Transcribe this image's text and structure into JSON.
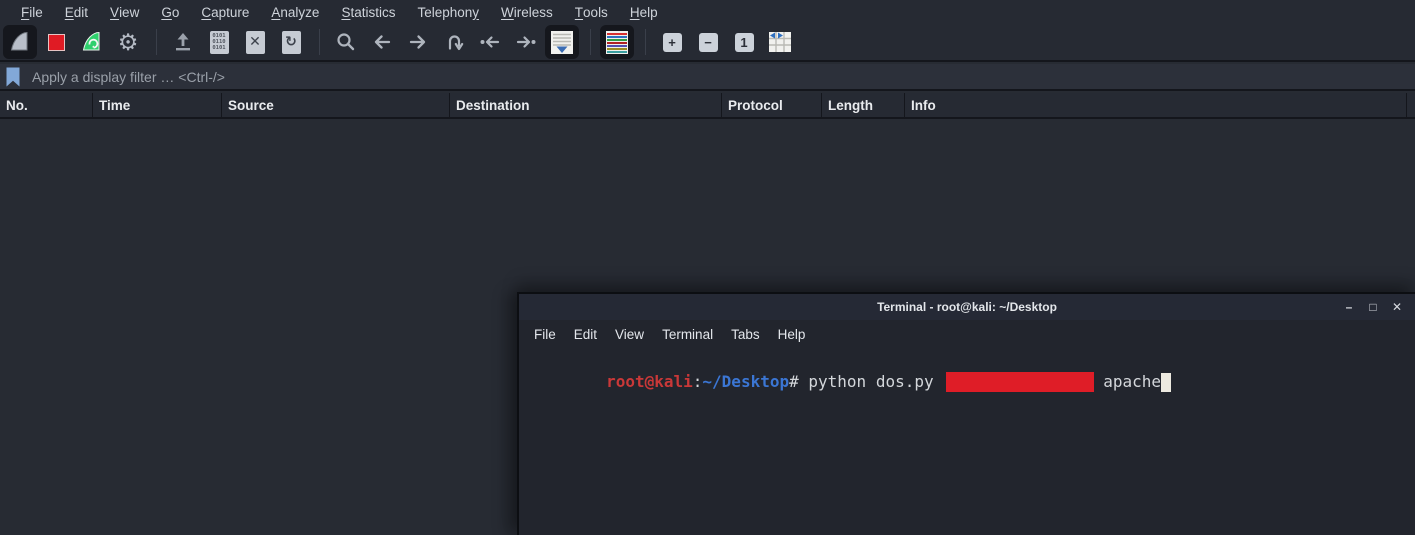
{
  "wireshark": {
    "menu": [
      {
        "pre": "",
        "u": "F",
        "rest": "ile"
      },
      {
        "pre": "",
        "u": "E",
        "rest": "dit"
      },
      {
        "pre": "",
        "u": "V",
        "rest": "iew"
      },
      {
        "pre": "",
        "u": "G",
        "rest": "o"
      },
      {
        "pre": "",
        "u": "C",
        "rest": "apture"
      },
      {
        "pre": "",
        "u": "A",
        "rest": "nalyze"
      },
      {
        "pre": "",
        "u": "S",
        "rest": "tatistics"
      },
      {
        "pre": "Telephon",
        "u": "y",
        "rest": ""
      },
      {
        "pre": "",
        "u": "W",
        "rest": "ireless"
      },
      {
        "pre": "",
        "u": "T",
        "rest": "ools"
      },
      {
        "pre": "",
        "u": "H",
        "rest": "elp"
      }
    ],
    "toolbar_icons": [
      "start-capture-shark-fin",
      "stop-capture",
      "restart-capture",
      "capture-options-gear",
      "open-capture",
      "save-capture",
      "close-capture",
      "reload-capture",
      "find-packet",
      "go-back",
      "go-forward",
      "go-to-packet",
      "first-packet",
      "last-packet",
      "auto-scroll",
      "colorize-packets",
      "zoom-in",
      "zoom-out",
      "normal-size",
      "resize-columns"
    ],
    "filter": {
      "placeholder": "Apply a display filter … <Ctrl-/>"
    },
    "columns": [
      {
        "label": "No."
      },
      {
        "label": "Time"
      },
      {
        "label": "Source"
      },
      {
        "label": "Destination"
      },
      {
        "label": "Protocol"
      },
      {
        "label": "Length"
      },
      {
        "label": "Info"
      }
    ],
    "packet_list_rows": []
  },
  "terminal": {
    "title": "Terminal - root@kali: ~/Desktop",
    "window_controls": {
      "minimize": "–",
      "maximize": "□",
      "close": "✕"
    },
    "menu": [
      "File",
      "Edit",
      "View",
      "Terminal",
      "Tabs",
      "Help"
    ],
    "prompt": {
      "user": "root@kali",
      "separator": ":",
      "path": "~/Desktop",
      "symbol": "#",
      "command": " python dos.py",
      "redacted_argument": true,
      "suffix": " apache"
    }
  },
  "toolbar_glyphs": {
    "gear": "⚙",
    "reload": "↻",
    "zoom_in": "+",
    "zoom_out": "−",
    "normal_size": "1",
    "binary_row1": "0101",
    "binary_row2": "0110",
    "doc_close": "✕"
  },
  "colors": {
    "chrome_bg": "#262a33",
    "packet_list_bg": "#272b33",
    "terminal_bg": "#22252d",
    "accent_red": "#e01b24",
    "accent_green": "#2fd06d",
    "bookmark_blue": "#82a8d8",
    "prompt_user_red": "#c93838",
    "prompt_path_blue": "#3b76d4",
    "redaction_red": "#df1d27"
  }
}
